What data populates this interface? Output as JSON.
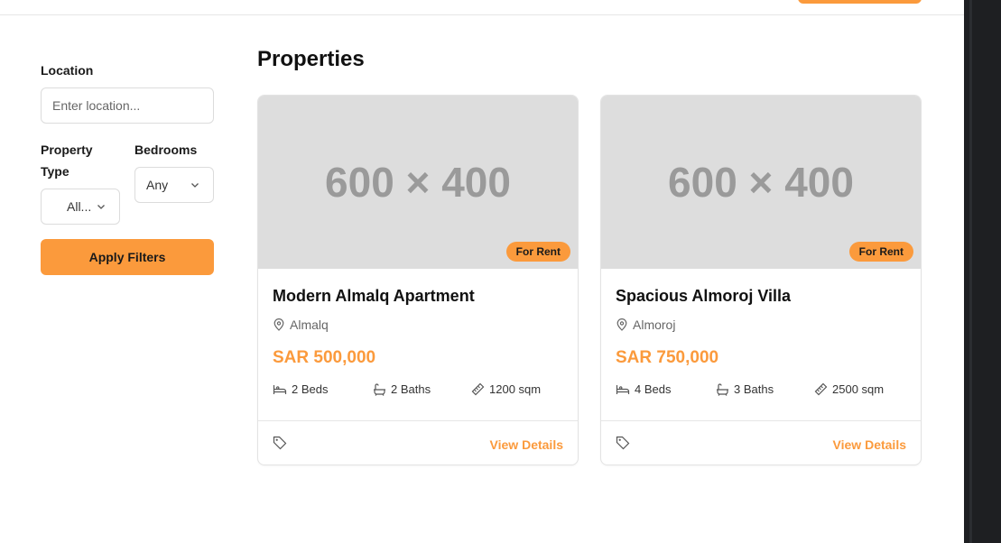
{
  "filters": {
    "location_label": "Location",
    "location_placeholder": "Enter location...",
    "property_type_label_line1": "Property",
    "property_type_label_line2": "Type",
    "property_type_value": "All...",
    "bedrooms_label": "Bedrooms",
    "bedrooms_value": "Any",
    "apply_label": "Apply Filters"
  },
  "page": {
    "title": "Properties"
  },
  "properties": [
    {
      "image_text": "600 × 400",
      "badge": "For Rent",
      "title": "Modern Almalq Apartment",
      "location": "Almalq",
      "price": "SAR 500,000",
      "beds": "2 Beds",
      "baths": "2 Baths",
      "area": "1200 sqm",
      "action": "View Details"
    },
    {
      "image_text": "600 × 400",
      "badge": "For Rent",
      "title": "Spacious Almoroj Villa",
      "location": "Almoroj",
      "price": "SAR 750,000",
      "beds": "4 Beds",
      "baths": "3 Baths",
      "area": "2500 sqm",
      "action": "View Details"
    }
  ],
  "colors": {
    "accent": "#fb9a3c",
    "placeholder_bg": "#dddddd"
  },
  "icons": [
    "map-pin-icon",
    "bed-icon",
    "bath-icon",
    "ruler-icon",
    "tag-icon",
    "chevron-down-icon"
  ]
}
